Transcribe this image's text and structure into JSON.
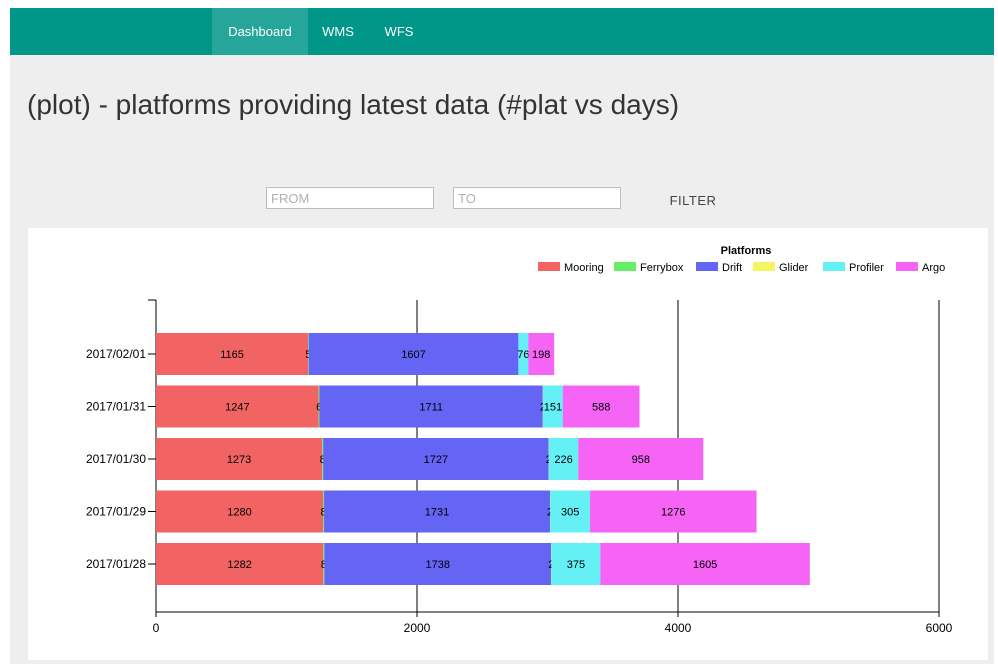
{
  "nav": {
    "items": [
      {
        "label": "Dashboard",
        "active": true
      },
      {
        "label": "WMS",
        "active": false
      },
      {
        "label": "WFS",
        "active": false
      }
    ]
  },
  "page": {
    "title": "(plot) - platforms providing latest data (#plat vs days)"
  },
  "filter": {
    "from_placeholder": "FROM",
    "to_placeholder": "TO",
    "from_value": "",
    "to_value": "",
    "button_label": "FILTER"
  },
  "colors": {
    "nav_bg": "#009688",
    "nav_active": "#26a69a",
    "page_bg": "#eeeeee"
  },
  "chart_data": {
    "type": "bar",
    "orientation": "horizontal",
    "stacked": true,
    "legend_title": "Platforms",
    "legend_position": "top-right",
    "categories": [
      "2017/02/01",
      "2017/01/31",
      "2017/01/30",
      "2017/01/29",
      "2017/01/28"
    ],
    "series": [
      {
        "name": "Mooring",
        "color": "#f26464",
        "values": [
          1165,
          1247,
          1273,
          1280,
          1282
        ]
      },
      {
        "name": "Ferrybox",
        "color": "#66ee66",
        "values": [
          5,
          6,
          8,
          8,
          8
        ]
      },
      {
        "name": "Drift",
        "color": "#6464f5",
        "values": [
          1607,
          1711,
          1727,
          1731,
          1738
        ]
      },
      {
        "name": "Glider",
        "color": "#f5f564",
        "values": [
          0,
          2,
          2,
          2,
          2
        ]
      },
      {
        "name": "Profiler",
        "color": "#64f0f5",
        "values": [
          76,
          151,
          226,
          305,
          375
        ]
      },
      {
        "name": "Argo",
        "color": "#f564f5",
        "values": [
          198,
          588,
          958,
          1276,
          1605
        ]
      }
    ],
    "data_labels": [
      [
        "1165",
        "5",
        "1607",
        "",
        "76",
        "198"
      ],
      [
        "1247",
        "6",
        "1711",
        "2",
        "151",
        "588"
      ],
      [
        "1273",
        "8",
        "1727",
        "2",
        "226",
        "958"
      ],
      [
        "1280",
        "8",
        "1731",
        "2",
        "305",
        "1276"
      ],
      [
        "1282",
        "8",
        "1738",
        "2",
        "375",
        "1605"
      ]
    ],
    "xlim": [
      0,
      6000
    ],
    "xticks": [
      0,
      2000,
      4000,
      6000
    ],
    "grid": "vertical"
  }
}
